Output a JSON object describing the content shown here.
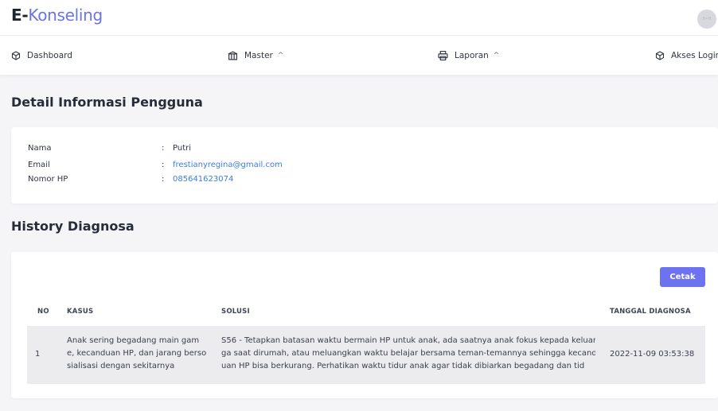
{
  "brand": {
    "bold": "E-",
    "name": "Konseling",
    "avatar_text": "H•H"
  },
  "nav": {
    "dashboard": "Dashboard",
    "master": "Master",
    "laporan": "Laporan",
    "akses": "Akses Login",
    "chevron": "^"
  },
  "detail": {
    "title": "Detail Informasi Pengguna",
    "separator": ":",
    "fields": [
      {
        "label": "Nama",
        "value": "Putri"
      },
      {
        "label": "Email",
        "value": "frestianyregina@gmail.com"
      },
      {
        "label": "Nomor HP",
        "value": "085641623074"
      }
    ]
  },
  "history": {
    "title": "History Diagnosa",
    "cetak_label": "Cetak",
    "headers": {
      "no": "NO",
      "kasus": "KASUS",
      "solusi": "SOLUSI",
      "tanggal": "TANGGAL DIAGNOSA"
    },
    "rows": [
      {
        "no": "1",
        "kasus": [
          "Anak sering begadang main gam",
          "e, kecanduan HP, dan jarang berso",
          "sialisasi dengan sekitarnya"
        ],
        "solusi": [
          "S56 - Tetapkan batasan waktu bermain HP untuk anak, ada saatnya anak fokus kepada keluar",
          "ga saat dirumah, atau meluangkan waktu belajar bersama teman-temannya sehingga kecand",
          "uan HP bisa berkurang. Perhatikan waktu tidur anak agar tidak dibiarkan begadang dan tid"
        ],
        "tanggal": "2022-11-09 03:53:38"
      }
    ]
  },
  "colors": {
    "brand_accent": "#6a73e8",
    "button": "#6d72f0",
    "link": "#3b7de0"
  }
}
